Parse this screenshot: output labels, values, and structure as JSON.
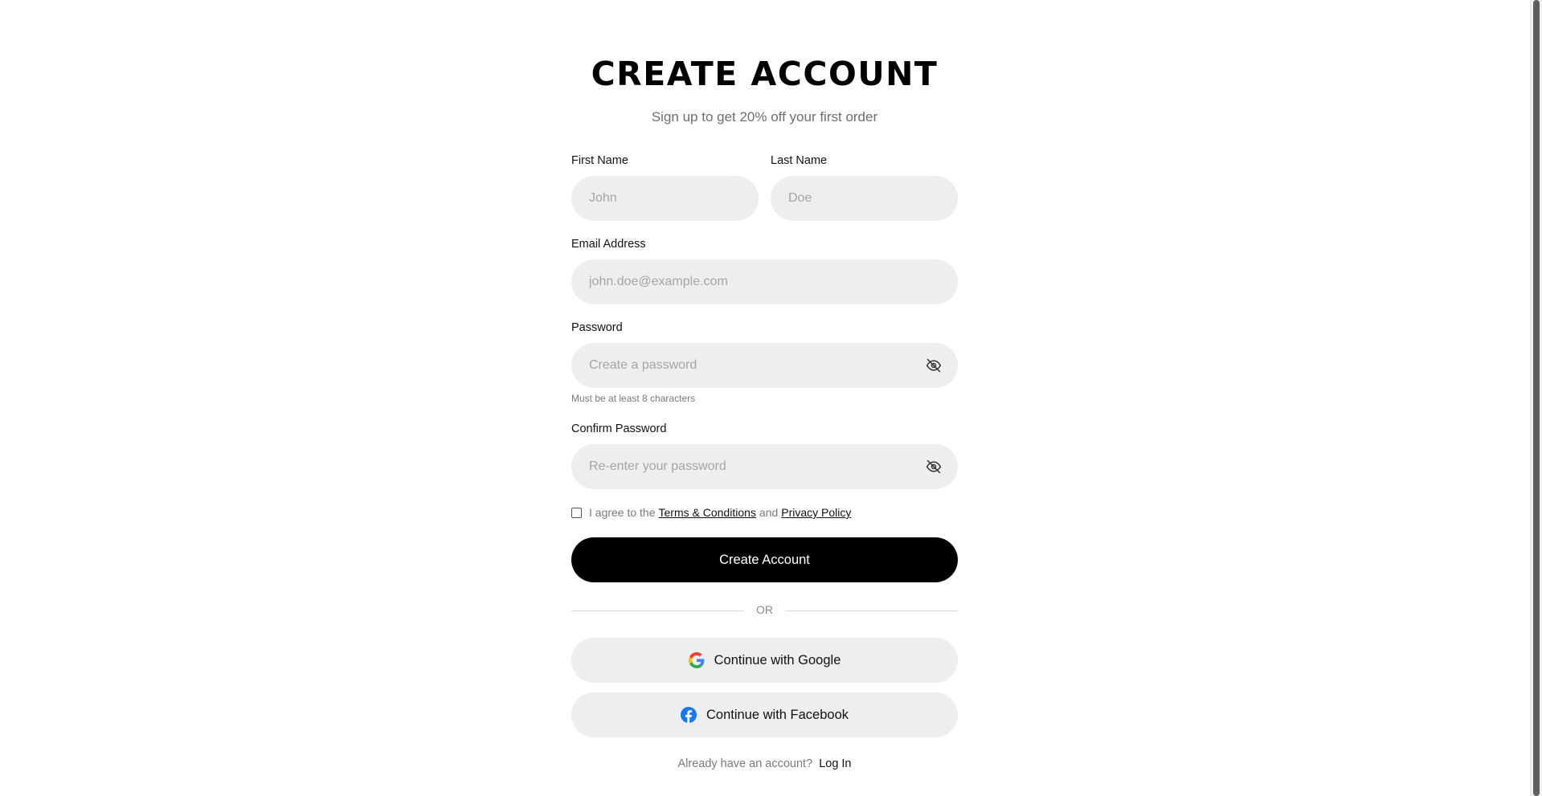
{
  "header": {
    "title": "CREATE ACCOUNT",
    "subtitle": "Sign up to get 20% off your first order"
  },
  "form": {
    "first_name": {
      "label": "First Name",
      "placeholder": "John",
      "value": ""
    },
    "last_name": {
      "label": "Last Name",
      "placeholder": "Doe",
      "value": ""
    },
    "email": {
      "label": "Email Address",
      "placeholder": "john.doe@example.com",
      "value": ""
    },
    "password": {
      "label": "Password",
      "placeholder": "Create a password",
      "value": "",
      "hint": "Must be at least 8 characters",
      "toggle_icon": "eye-off-icon"
    },
    "confirm_password": {
      "label": "Confirm Password",
      "placeholder": "Re-enter your password",
      "value": "",
      "toggle_icon": "eye-off-icon"
    },
    "agree": {
      "checked": false,
      "prefix": "I agree to the",
      "terms_link": "Terms & Conditions",
      "joiner": "and",
      "privacy_link": "Privacy Policy"
    },
    "submit_label": "Create Account"
  },
  "divider": {
    "label": "OR"
  },
  "social": {
    "google_label": "Continue with Google",
    "google_icon": "google-icon",
    "facebook_label": "Continue with Facebook",
    "facebook_icon": "facebook-icon"
  },
  "footer": {
    "prompt": "Already have an account?",
    "login_link": "Log In"
  },
  "colors": {
    "primary_button": "#000000",
    "input_background": "#eeeeee",
    "facebook_blue": "#1877f2"
  }
}
